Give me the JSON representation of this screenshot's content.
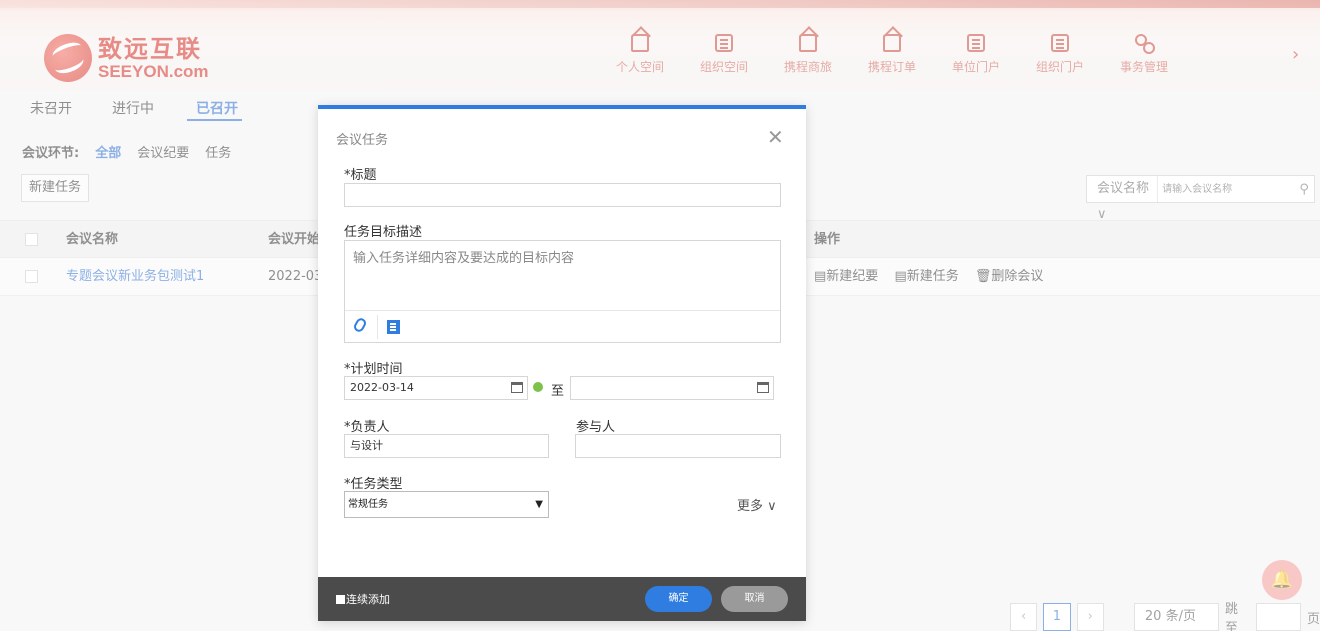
{
  "brand": {
    "cn": "致远互联",
    "en": "SEEYON.com"
  },
  "nav": [
    {
      "label": "个人空间",
      "icon": "home-icon"
    },
    {
      "label": "组织空间",
      "icon": "building-icon"
    },
    {
      "label": "携程商旅",
      "icon": "home-icon"
    },
    {
      "label": "携程订单",
      "icon": "home-icon"
    },
    {
      "label": "单位门户",
      "icon": "document-icon"
    },
    {
      "label": "组织门户",
      "icon": "document-icon"
    },
    {
      "label": "事务管理",
      "icon": "flow-icon"
    }
  ],
  "tabs": [
    "未召开",
    "进行中",
    "已召开"
  ],
  "filter": {
    "label": "会议环节:",
    "items": [
      "全部",
      "会议纪要",
      "任务"
    ]
  },
  "toolbar": {
    "new_task": "新建任务"
  },
  "search": {
    "field": "会议名称",
    "placeholder": "请输入会议名称"
  },
  "table": {
    "headers": [
      "会议名称",
      "会议开始",
      "操作"
    ],
    "rows": [
      {
        "name": "专题会议新业务包测试1",
        "start": "2022-03-",
        "ops": [
          "新建纪要",
          "新建任务",
          "删除会议"
        ]
      }
    ]
  },
  "pager": {
    "current": "1",
    "size": "20 条/页",
    "jump_label": "跳至",
    "page_suffix": "页"
  },
  "dialog": {
    "title": "会议任务",
    "fields": {
      "title_label": "*标题",
      "desc_label": "任务目标描述",
      "desc_placeholder": "输入任务详细内容及要达成的目标内容",
      "plan_label": "*计划时间",
      "start_date": "2022-03-14",
      "to": "至",
      "owner_label": "*负责人",
      "owner_value": "与设计",
      "participant_label": "参与人",
      "type_label": "*任务类型",
      "type_value": "常规任务",
      "more": "更多"
    },
    "footer": {
      "continue_add": "连续添加",
      "ok": "确定",
      "cancel": "取消"
    }
  },
  "colors": {
    "accent": "#2f7de1",
    "brand": "#d42c23"
  }
}
